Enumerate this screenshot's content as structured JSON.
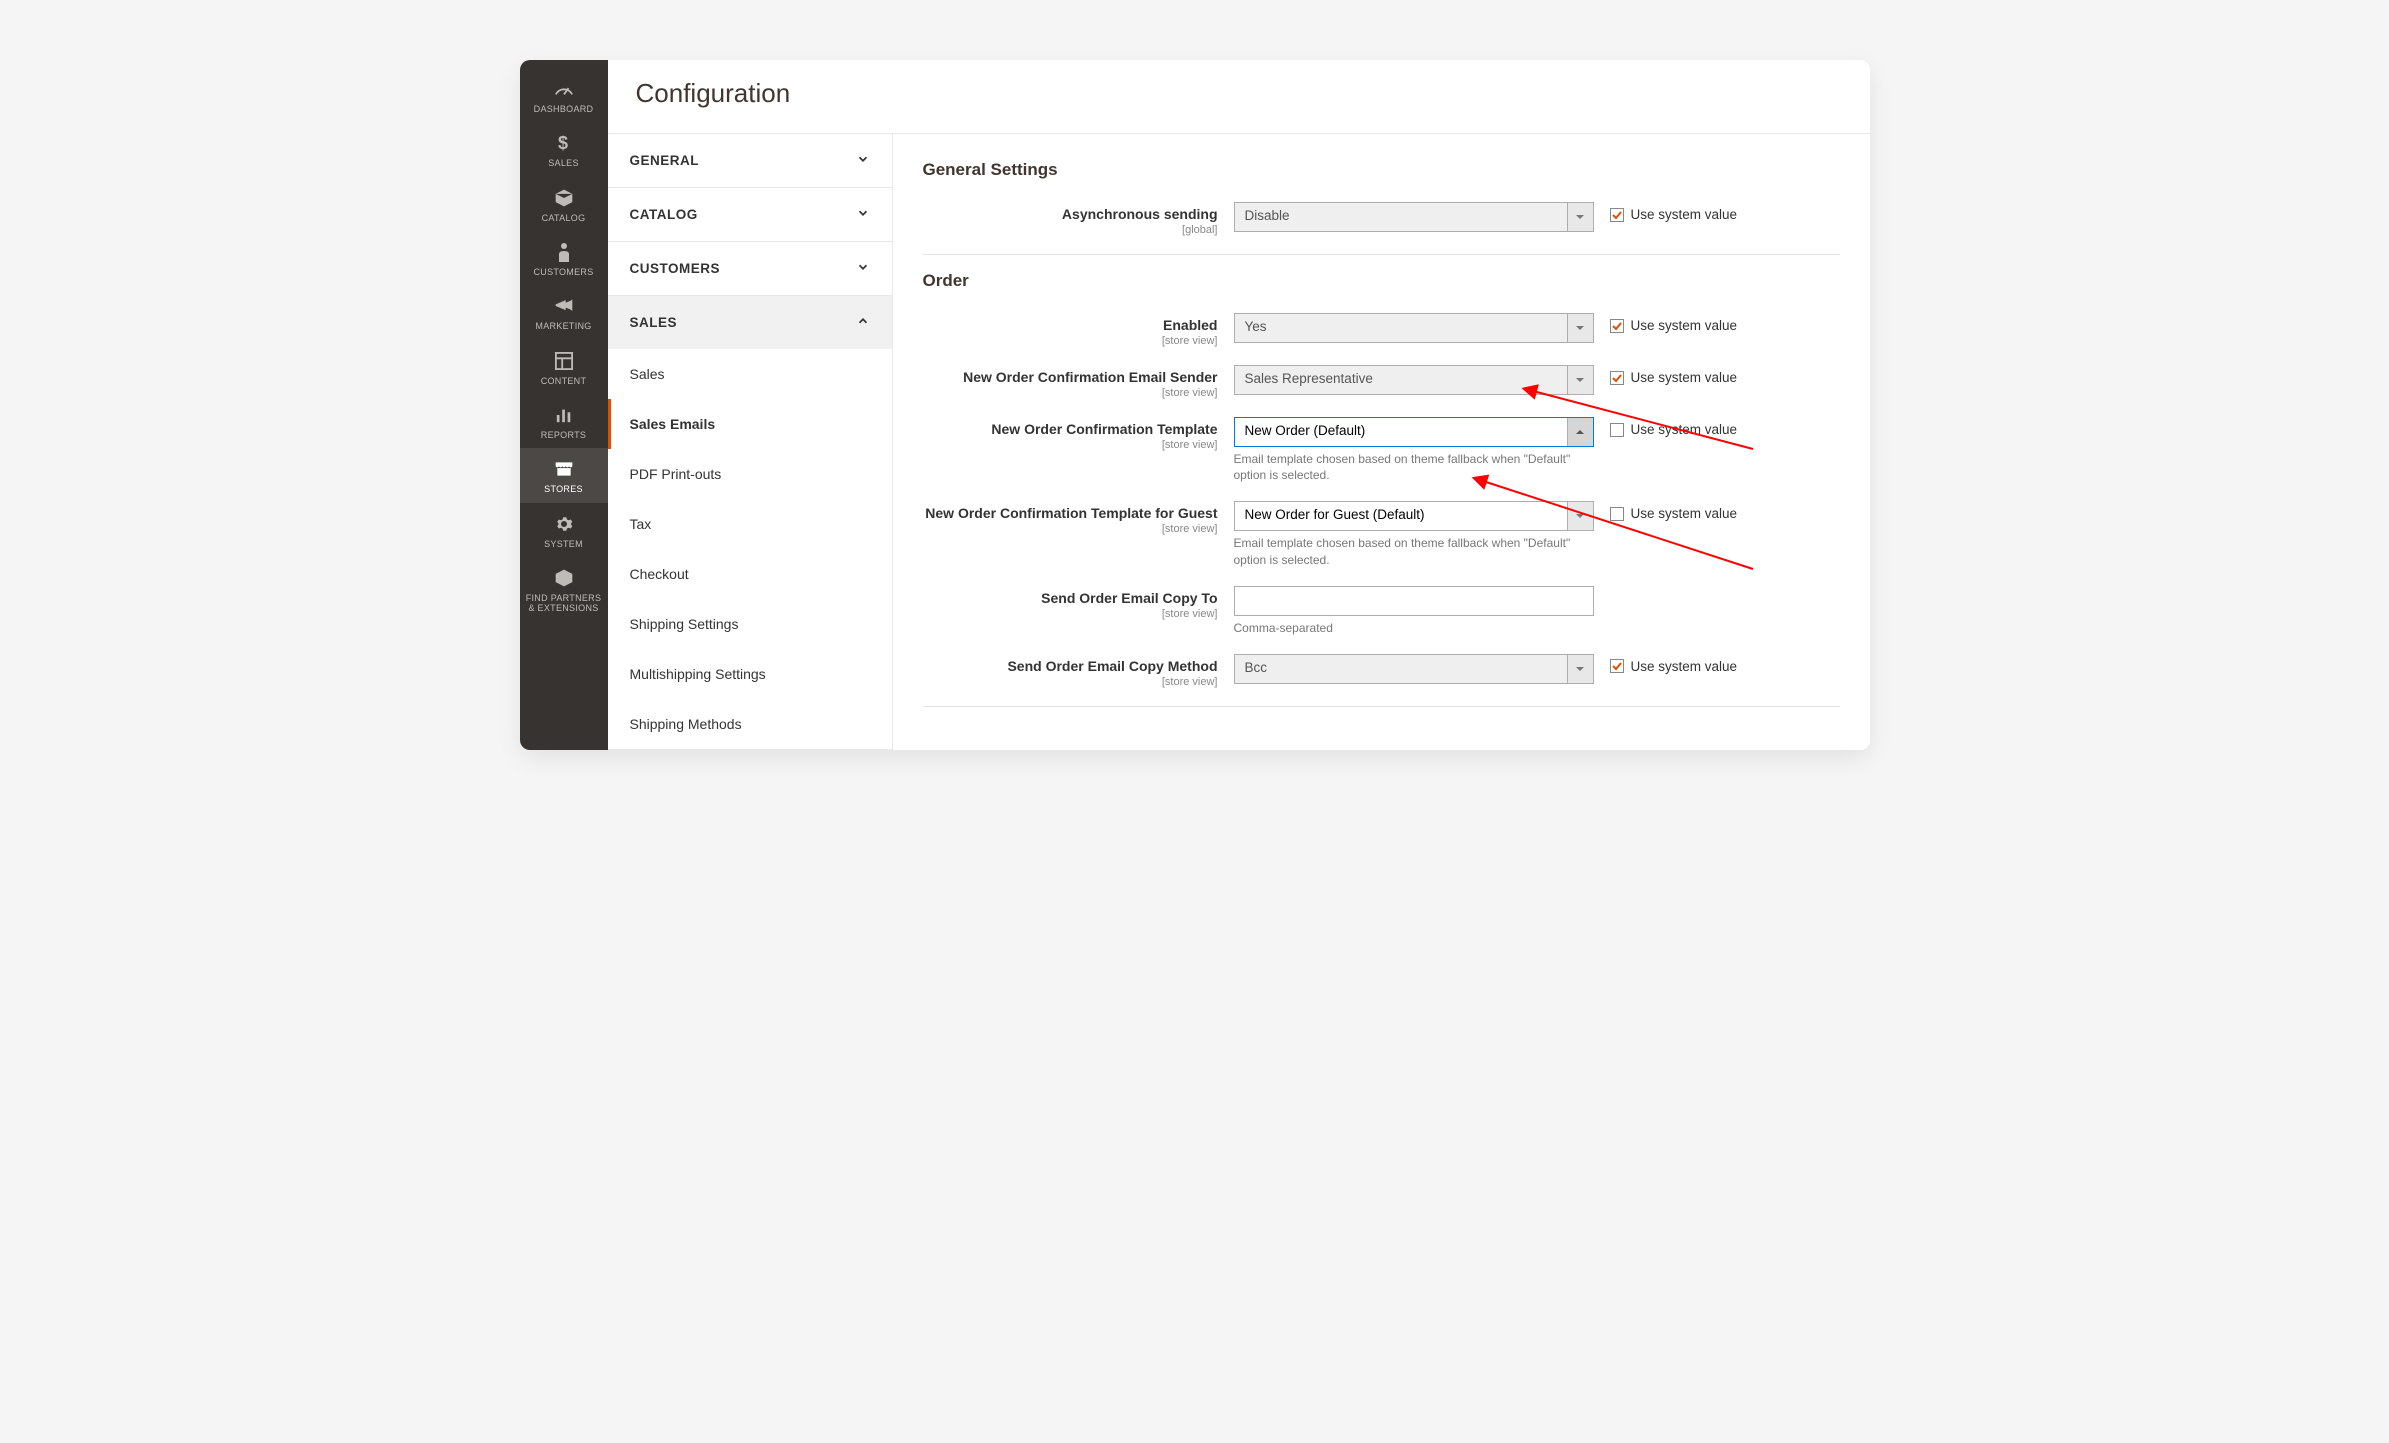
{
  "rail": {
    "items": [
      {
        "label": "DASHBOARD"
      },
      {
        "label": "SALES"
      },
      {
        "label": "CATALOG"
      },
      {
        "label": "CUSTOMERS"
      },
      {
        "label": "MARKETING"
      },
      {
        "label": "CONTENT"
      },
      {
        "label": "REPORTS"
      },
      {
        "label": "STORES"
      },
      {
        "label": "SYSTEM"
      },
      {
        "label": "FIND PARTNERS & EXTENSIONS"
      }
    ]
  },
  "page": {
    "title": "Configuration"
  },
  "tabs": {
    "groups": [
      {
        "label": "GENERAL"
      },
      {
        "label": "CATALOG"
      },
      {
        "label": "CUSTOMERS"
      },
      {
        "label": "SALES"
      }
    ],
    "salesSub": [
      {
        "label": "Sales"
      },
      {
        "label": "Sales Emails"
      },
      {
        "label": "PDF Print-outs"
      },
      {
        "label": "Tax"
      },
      {
        "label": "Checkout"
      },
      {
        "label": "Shipping Settings"
      },
      {
        "label": "Multishipping Settings"
      },
      {
        "label": "Shipping Methods"
      }
    ]
  },
  "sections": {
    "general": {
      "title": "General Settings",
      "async": {
        "label": "Asynchronous sending",
        "scope": "[global]",
        "value": "Disable",
        "use_label": "Use system value"
      }
    },
    "order": {
      "title": "Order",
      "enabled": {
        "label": "Enabled",
        "scope": "[store view]",
        "value": "Yes",
        "use_label": "Use system value"
      },
      "sender": {
        "label": "New Order Confirmation Email Sender",
        "scope": "[store view]",
        "value": "Sales Representative",
        "use_label": "Use system value"
      },
      "template": {
        "label": "New Order Confirmation Template",
        "scope": "[store view]",
        "value": "New Order (Default)",
        "hint": "Email template chosen based on theme fallback when \"Default\" option is selected.",
        "use_label": "Use system value"
      },
      "template_guest": {
        "label": "New Order Confirmation Template for Guest",
        "scope": "[store view]",
        "value": "New Order for Guest (Default)",
        "hint": "Email template chosen based on theme fallback when \"Default\" option is selected.",
        "use_label": "Use system value"
      },
      "copy_to": {
        "label": "Send Order Email Copy To",
        "scope": "[store view]",
        "value": "",
        "hint": "Comma-separated"
      },
      "copy_method": {
        "label": "Send Order Email Copy Method",
        "scope": "[store view]",
        "value": "Bcc",
        "use_label": "Use system value"
      }
    }
  }
}
